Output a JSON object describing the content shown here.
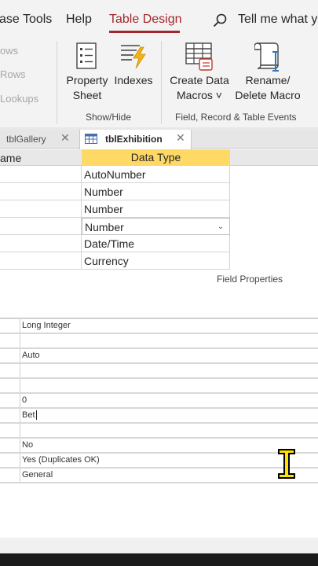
{
  "menubar": {
    "items": [
      {
        "label": "ase Tools",
        "active": false
      },
      {
        "label": "Help",
        "active": false
      },
      {
        "label": "Table Design",
        "active": true
      }
    ],
    "search_text": "Tell me what yo",
    "accent_color": "#a4262c"
  },
  "ribbon": {
    "left_partial_items": [
      "ows",
      "Rows",
      "Lookups"
    ],
    "buttons": {
      "property_sheet": {
        "line1": "Property",
        "line2": "Sheet",
        "icon": "property-sheet-icon"
      },
      "indexes": {
        "label": "Indexes",
        "icon": "indexes-lightning-icon"
      },
      "create_data_macros": {
        "line1": "Create Data",
        "line2": "Macros ˅",
        "icon": "create-data-macros-icon"
      },
      "rename_delete_macro": {
        "line1": "Rename/",
        "line2": "Delete Macro",
        "icon": "rename-delete-macro-icon"
      }
    },
    "groups": {
      "show_hide": "Show/Hide",
      "field_record_events": "Field, Record & Table Events"
    }
  },
  "tabs": [
    {
      "label": "tblGallery",
      "active": false,
      "close": "✕"
    },
    {
      "label": "tblExhibition",
      "active": true,
      "close": "✕",
      "icon": "table-icon"
    }
  ],
  "grid": {
    "headers": {
      "name": "ame",
      "type": "Data Type"
    },
    "header_highlight_color": "#ffd966",
    "rows": [
      {
        "type": "AutoNumber"
      },
      {
        "type": "Number"
      },
      {
        "type": "Number"
      },
      {
        "type": "Number",
        "selected": true
      },
      {
        "type": "Date/Time"
      },
      {
        "type": "Currency"
      }
    ]
  },
  "field_properties_label": "Field Properties",
  "properties": [
    {
      "value": "Long Integer"
    },
    {
      "value": ""
    },
    {
      "value": "Auto"
    },
    {
      "value": ""
    },
    {
      "value": ""
    },
    {
      "value": "0"
    },
    {
      "value": "Bet",
      "editing": true
    },
    {
      "value": ""
    },
    {
      "value": "No"
    },
    {
      "value": "Yes (Duplicates OK)"
    },
    {
      "value": "General"
    }
  ]
}
